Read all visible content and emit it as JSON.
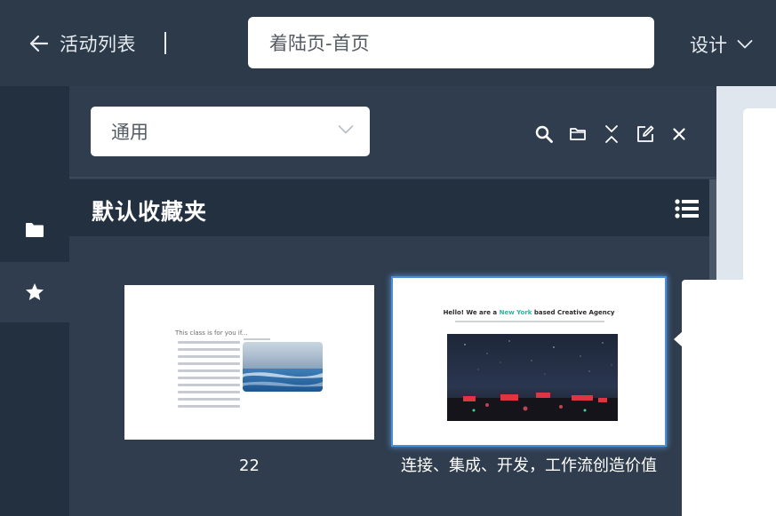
{
  "header": {
    "back_label": "活动列表",
    "title_value": "着陆页-首页",
    "mode_label": "设计"
  },
  "panel": {
    "category_value": "通用",
    "section_title": "默认收藏夹"
  },
  "cards": [
    {
      "label": "22",
      "slide_title": "This class is for you if..."
    },
    {
      "label": "连接、集成、开发，工作流创造价值",
      "headline_pre": "Hello! We are a ",
      "headline_accent": "New York",
      "headline_post": " based Creative Agency"
    }
  ],
  "icons": {
    "back": "arrow-left-icon",
    "mode_dropdown": "chevron-down-icon",
    "select_dropdown": "chevron-down-icon",
    "search": "search-icon",
    "folder_tool": "folder-icon",
    "collapse": "collapse-icon",
    "edit": "edit-icon",
    "close": "close-icon",
    "list": "list-icon",
    "rail_folder": "folder-icon",
    "rail_star": "star-icon"
  },
  "colors": {
    "header_bg": "#2c3a4a",
    "panel_bg": "#2f3d4e",
    "section_bg": "#233040",
    "selection_border": "#4b8fd8",
    "accent_teal": "#2bb5a0"
  }
}
